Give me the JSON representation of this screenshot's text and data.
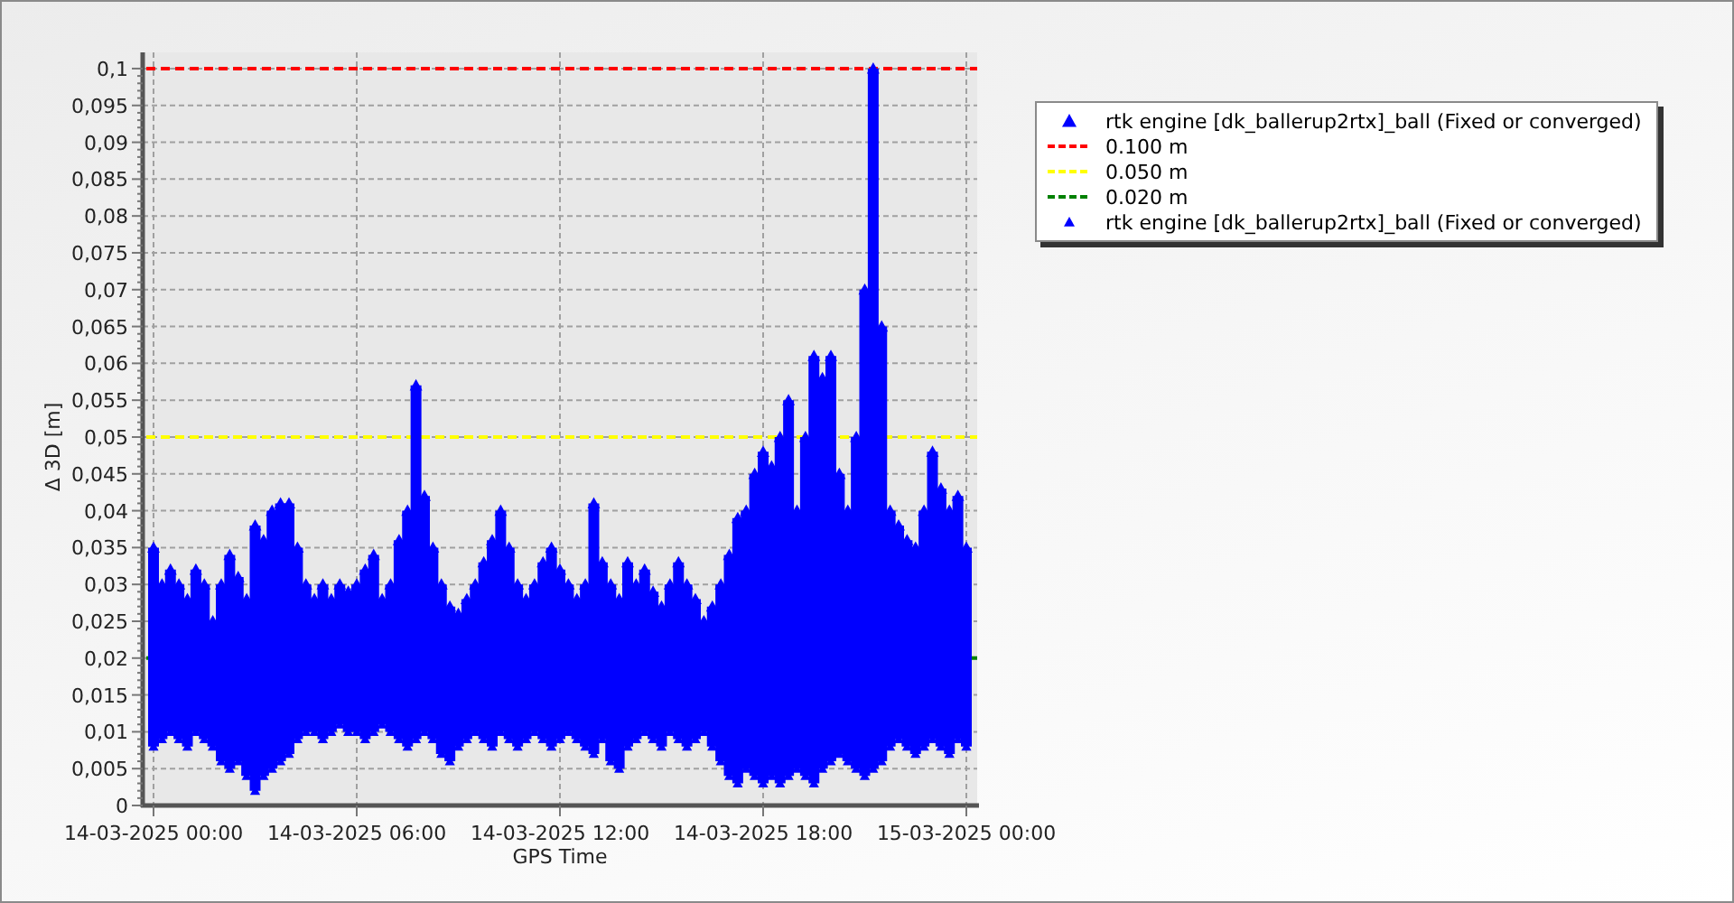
{
  "chart_data": {
    "type": "scatter",
    "xlabel": "GPS Time",
    "ylabel": "Δ 3D [m]",
    "categories": [
      "14-03-2025 00:00",
      null,
      null,
      null,
      null,
      null,
      null,
      null,
      null,
      null,
      null,
      null,
      null,
      null,
      null,
      null,
      null,
      null,
      null,
      null,
      null,
      null,
      null,
      null,
      "14-03-2025 06:00",
      null,
      null,
      null,
      null,
      null,
      null,
      null,
      null,
      null,
      null,
      null,
      null,
      null,
      null,
      null,
      null,
      null,
      null,
      null,
      null,
      null,
      null,
      null,
      "14-03-2025 12:00",
      null,
      null,
      null,
      null,
      null,
      null,
      null,
      null,
      null,
      null,
      null,
      null,
      null,
      null,
      null,
      null,
      null,
      null,
      null,
      null,
      null,
      null,
      null,
      "14-03-2025 18:00",
      null,
      null,
      null,
      null,
      null,
      null,
      null,
      null,
      null,
      null,
      null,
      null,
      null,
      null,
      null,
      null,
      null,
      null,
      null,
      null,
      null,
      null,
      null,
      "15-03-2025 00:00"
    ],
    "ylim": [
      0,
      0.1022
    ],
    "yticks": [
      {
        "value": 0,
        "label": "0"
      },
      {
        "value": 0.005,
        "label": "0,005"
      },
      {
        "value": 0.01,
        "label": "0,01"
      },
      {
        "value": 0.015,
        "label": "0,015"
      },
      {
        "value": 0.02,
        "label": "0,02"
      },
      {
        "value": 0.025,
        "label": "0,025"
      },
      {
        "value": 0.03,
        "label": "0,03"
      },
      {
        "value": 0.035,
        "label": "0,035"
      },
      {
        "value": 0.04,
        "label": "0,04"
      },
      {
        "value": 0.045,
        "label": "0,045"
      },
      {
        "value": 0.05,
        "label": "0,05"
      },
      {
        "value": 0.055,
        "label": "0,055"
      },
      {
        "value": 0.06,
        "label": "0,06"
      },
      {
        "value": 0.065,
        "label": "0,065"
      },
      {
        "value": 0.07,
        "label": "0,07"
      },
      {
        "value": 0.075,
        "label": "0,075"
      },
      {
        "value": 0.08,
        "label": "0,08"
      },
      {
        "value": 0.085,
        "label": "0,085"
      },
      {
        "value": 0.09,
        "label": "0,09"
      },
      {
        "value": 0.095,
        "label": "0,095"
      },
      {
        "value": 0.1,
        "label": "0,1"
      }
    ],
    "series": [
      {
        "name": "rtk engine [dk_ballerup2rtx]_ball (Fixed or converged)",
        "color": "#0000ff",
        "values": [
          0.035,
          0.03,
          0.032,
          0.03,
          0.028,
          0.032,
          0.03,
          0.025,
          0.03,
          0.034,
          0.031,
          0.028,
          0.038,
          0.036,
          0.04,
          0.041,
          0.041,
          0.035,
          0.03,
          0.028,
          0.03,
          0.028,
          0.03,
          0.029,
          0.03,
          0.032,
          0.034,
          0.028,
          0.03,
          0.036,
          0.04,
          0.057,
          0.042,
          0.035,
          0.03,
          0.027,
          0.026,
          0.028,
          0.03,
          0.033,
          0.036,
          0.04,
          0.035,
          0.03,
          0.028,
          0.03,
          0.033,
          0.035,
          0.032,
          0.03,
          0.028,
          0.03,
          0.041,
          0.033,
          0.03,
          0.028,
          0.033,
          0.03,
          0.032,
          0.029,
          0.027,
          0.03,
          0.033,
          0.03,
          0.028,
          0.025,
          0.027,
          0.03,
          0.034,
          0.039,
          0.04,
          0.045,
          0.048,
          0.046,
          0.05,
          0.055,
          0.04,
          0.05,
          0.061,
          0.058,
          0.061,
          0.045,
          0.04,
          0.05,
          0.07,
          0.1,
          0.065,
          0.04,
          0.038,
          0.036,
          0.035,
          0.04,
          0.048,
          0.043,
          0.04,
          0.042,
          0.035
        ]
      },
      {
        "name": "rtk engine [dk_ballerup2rtx]_ball (Fixed or converged)",
        "color": "#0000ff",
        "values": [
          0.008,
          0.009,
          0.01,
          0.009,
          0.008,
          0.01,
          0.009,
          0.008,
          0.006,
          0.005,
          0.006,
          0.004,
          0.002,
          0.004,
          0.005,
          0.006,
          0.007,
          0.009,
          0.01,
          0.01,
          0.009,
          0.01,
          0.011,
          0.01,
          0.01,
          0.009,
          0.01,
          0.011,
          0.01,
          0.009,
          0.008,
          0.009,
          0.01,
          0.009,
          0.007,
          0.006,
          0.008,
          0.009,
          0.01,
          0.009,
          0.008,
          0.01,
          0.009,
          0.008,
          0.009,
          0.01,
          0.009,
          0.008,
          0.009,
          0.01,
          0.009,
          0.008,
          0.007,
          0.009,
          0.006,
          0.005,
          0.008,
          0.009,
          0.01,
          0.009,
          0.008,
          0.01,
          0.009,
          0.008,
          0.009,
          0.01,
          0.008,
          0.006,
          0.004,
          0.003,
          0.005,
          0.004,
          0.003,
          0.004,
          0.003,
          0.004,
          0.005,
          0.004,
          0.003,
          0.005,
          0.006,
          0.007,
          0.006,
          0.005,
          0.004,
          0.005,
          0.006,
          0.008,
          0.009,
          0.008,
          0.007,
          0.008,
          0.009,
          0.008,
          0.007,
          0.009,
          0.008
        ]
      }
    ],
    "ref_lines": [
      {
        "axis": "y",
        "value": 0.1,
        "color": "#ff0000",
        "label": "0.100 m"
      },
      {
        "axis": "y",
        "value": 0.05,
        "color": "#ffff00",
        "label": "0.050 m"
      },
      {
        "axis": "y",
        "value": 0.02,
        "color": "#008000",
        "label": "0.020 m"
      }
    ],
    "grid": true
  }
}
